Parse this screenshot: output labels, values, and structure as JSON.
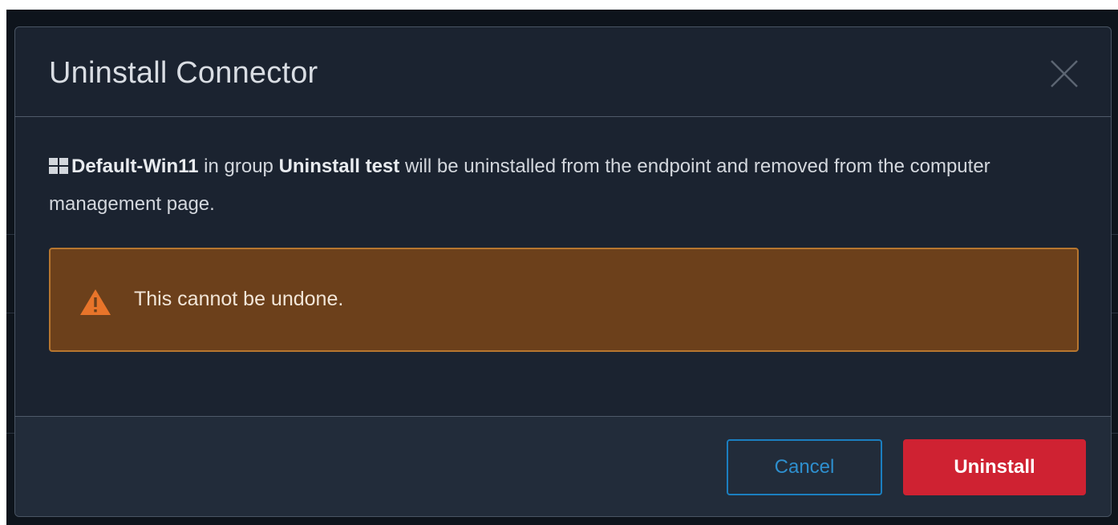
{
  "dialog": {
    "title": "Uninstall Connector",
    "close_icon": "close-icon"
  },
  "message": {
    "os_icon": "windows-icon",
    "computer_name": "Default-Win11",
    "text_in_group": "in group",
    "group_name": "Uninstall test",
    "text_rest": "will be uninstalled from the endpoint and removed from the computer management page."
  },
  "warning": {
    "icon": "warning-icon",
    "text": "This cannot be undone."
  },
  "footer": {
    "cancel_label": "Cancel",
    "uninstall_label": "Uninstall"
  },
  "colors": {
    "modal_bg": "#1b2330",
    "footer_bg": "#222c3a",
    "warning_bg": "#6c401b",
    "warning_border": "#b7762f",
    "warning_icon": "#e8742a",
    "cancel_border": "#1b7fc0",
    "uninstall_bg": "#cf2232"
  }
}
